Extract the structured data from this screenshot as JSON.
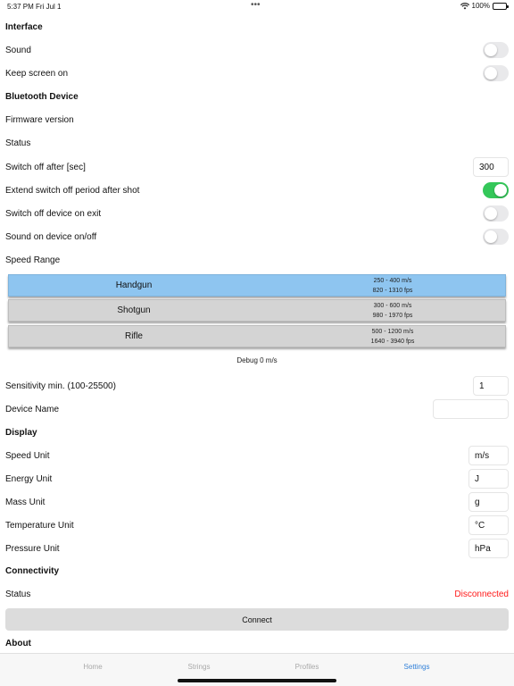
{
  "status_bar": {
    "time": "5:37 PM  Fri Jul 1",
    "dots": "•••",
    "battery": "100%"
  },
  "sections": {
    "interface": "Interface",
    "bluetooth": "Bluetooth Device",
    "display": "Display",
    "connectivity": "Connectivity",
    "about": "About"
  },
  "interface": {
    "sound": {
      "label": "Sound",
      "on": false
    },
    "keep_screen_on": {
      "label": "Keep screen on",
      "on": false
    }
  },
  "bluetooth": {
    "firmware": "Firmware version",
    "status": "Status",
    "switch_off_after": {
      "label": "Switch off after [sec]",
      "value": "300"
    },
    "extend_switch_off": {
      "label": "Extend switch off period after shot",
      "on": true
    },
    "switch_off_on_exit": {
      "label": "Switch off device on exit",
      "on": false
    },
    "sound_on_off": {
      "label": "Sound on device on/off",
      "on": false
    },
    "speed_range_label": "Speed Range",
    "speed_ranges": [
      {
        "name": "Handgun",
        "range_ms": "250 - 400 m/s",
        "range_fps": "820 - 1310 fps",
        "selected": true
      },
      {
        "name": "Shotgun",
        "range_ms": "300 - 600 m/s",
        "range_fps": "980 - 1970 fps",
        "selected": false
      },
      {
        "name": "Rifle",
        "range_ms": "500 - 1200 m/s",
        "range_fps": "1640 - 3940 fps",
        "selected": false
      }
    ],
    "debug": "Debug 0 m/s",
    "sensitivity": {
      "label": "Sensitivity min. (100-25500)",
      "value": "1"
    },
    "device_name": {
      "label": "Device Name",
      "value": ""
    }
  },
  "display": {
    "speed_unit": {
      "label": "Speed Unit",
      "value": "m/s"
    },
    "energy_unit": {
      "label": "Energy Unit",
      "value": "J"
    },
    "mass_unit": {
      "label": "Mass Unit",
      "value": "g"
    },
    "temperature_unit": {
      "label": "Temperature Unit",
      "value": "°C"
    },
    "pressure_unit": {
      "label": "Pressure Unit",
      "value": "hPa"
    }
  },
  "connectivity": {
    "status_label": "Status",
    "status_value": "Disconnected",
    "status_color": "#ff1a1a",
    "connect_label": "Connect"
  },
  "tabs": [
    {
      "label": "Home",
      "active": false
    },
    {
      "label": "Strings",
      "active": false
    },
    {
      "label": "Profiles",
      "active": false
    },
    {
      "label": "Settings",
      "active": true
    }
  ],
  "colors": {
    "accent": "#2f7fd8",
    "toggle_on": "#34c759",
    "selected_range": "#8ec5f0"
  }
}
